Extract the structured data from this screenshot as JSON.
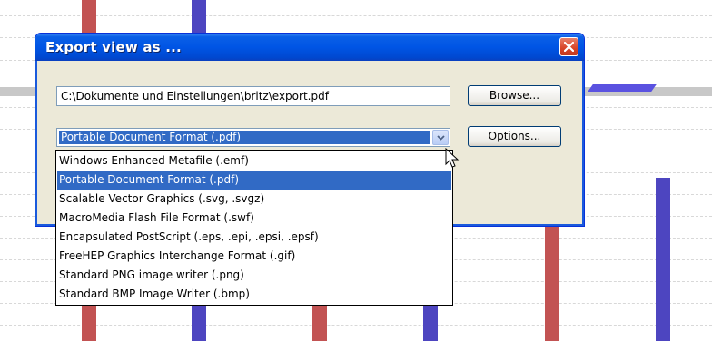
{
  "dialog": {
    "title": "Export view as ...",
    "file_path": "C:\\Dokumente und Einstellungen\\britz\\export.pdf",
    "browse_label": "Browse...",
    "options_label": "Options...",
    "selected_format": "Portable Document Format (.pdf)"
  },
  "format_list": {
    "items": [
      {
        "label": "Windows Enhanced Metafile (.emf)",
        "selected": false
      },
      {
        "label": "Portable Document Format (.pdf)",
        "selected": true
      },
      {
        "label": "Scalable Vector Graphics (.svg, .svgz)",
        "selected": false
      },
      {
        "label": "MacroMedia Flash File Format (.swf)",
        "selected": false
      },
      {
        "label": "Encapsulated PostScript (.eps, .epi, .epsi, .epsf)",
        "selected": false
      },
      {
        "label": "FreeHEP Graphics Interchange Format (.gif)",
        "selected": false
      },
      {
        "label": "Standard PNG image writer (.png)",
        "selected": false
      },
      {
        "label": "Standard BMP Image Writer (.bmp)",
        "selected": false
      }
    ]
  },
  "colors": {
    "bar_red": "#f77070",
    "bar_blue": "#6b63f0",
    "titlebar": "#0055e5",
    "selection": "#316ac5",
    "dialog_bg": "#ece9d8"
  },
  "icons": [
    "close-icon",
    "chevron-down-icon",
    "mouse-cursor-icon"
  ]
}
